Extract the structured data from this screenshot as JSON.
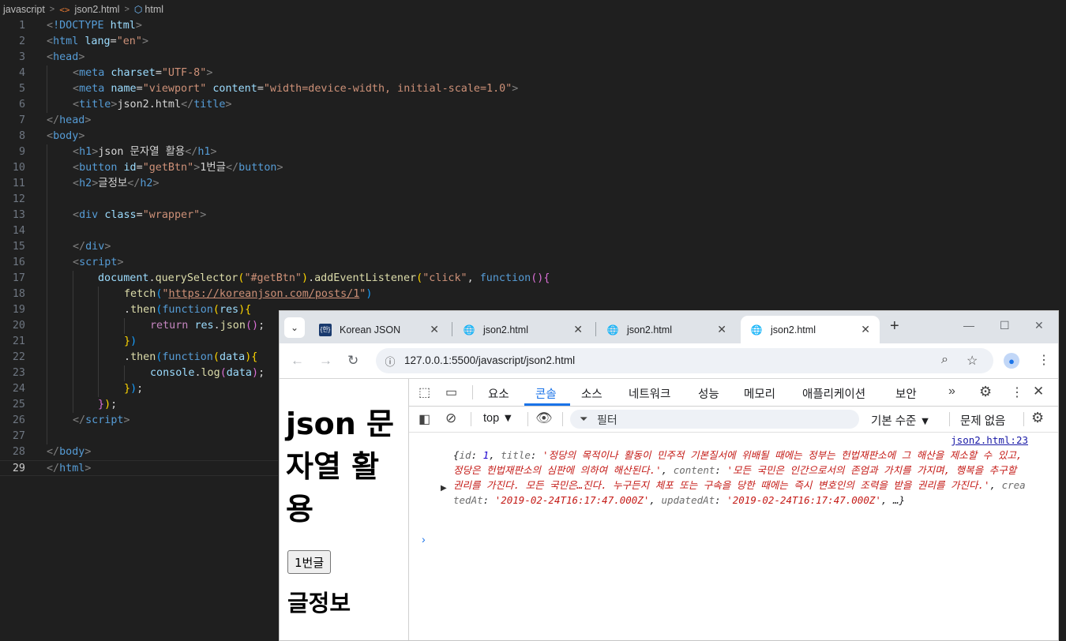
{
  "editor": {
    "breadcrumb": [
      "javascript",
      "json2.html",
      "html"
    ],
    "active_line": 29,
    "lines": [
      {
        "n": "1"
      },
      {
        "n": "2"
      },
      {
        "n": "3"
      },
      {
        "n": "4"
      },
      {
        "n": "5"
      },
      {
        "n": "6"
      },
      {
        "n": "7"
      },
      {
        "n": "8"
      },
      {
        "n": "9"
      },
      {
        "n": "10"
      },
      {
        "n": "11"
      },
      {
        "n": "12"
      },
      {
        "n": "13"
      },
      {
        "n": "14"
      },
      {
        "n": "15"
      },
      {
        "n": "16"
      },
      {
        "n": "17"
      },
      {
        "n": "18"
      },
      {
        "n": "19"
      },
      {
        "n": "20"
      },
      {
        "n": "21"
      },
      {
        "n": "22"
      },
      {
        "n": "23"
      },
      {
        "n": "24"
      },
      {
        "n": "25"
      },
      {
        "n": "26"
      },
      {
        "n": "27"
      },
      {
        "n": "28"
      },
      {
        "n": "29"
      }
    ],
    "code": {
      "doctype_kw": "!DOCTYPE",
      "doctype_val": "html",
      "html_tag": "html",
      "lang_attr": "lang",
      "lang_val": "\"en\"",
      "head_tag": "head",
      "meta_tag": "meta",
      "charset_attr": "charset",
      "charset_val": "\"UTF-8\"",
      "name_attr": "name",
      "name_val": "\"viewport\"",
      "content_attr": "content",
      "content_val": "\"width=device-width, initial-scale=1.0\"",
      "title_tag": "title",
      "title_text": "json2.html",
      "body_tag": "body",
      "h1_tag": "h1",
      "h1_text": "json 문자열 활용",
      "button_tag": "button",
      "id_attr": "id",
      "id_val": "\"getBtn\"",
      "button_text": "1번글",
      "h2_tag": "h2",
      "h2_text": "글정보",
      "div_tag": "div",
      "class_attr": "class",
      "class_val": "\"wrapper\"",
      "script_tag": "script",
      "l17_obj": "document",
      "l17_fn": "querySelector",
      "l17_arg": "\"#getBtn\"",
      "l17_fn2": "addEventListener",
      "l17_ev": "\"click\"",
      "function_kw": "function",
      "fetch_fn": "fetch",
      "fetch_q": "\"",
      "fetch_url": "https://koreanjson.com/posts/1",
      "then_fn": "then",
      "res_param": "res",
      "return_kw": "return",
      "json_fn": "json",
      "data_param": "data",
      "console_obj": "console",
      "log_fn": "log"
    }
  },
  "browser": {
    "tabs": [
      {
        "title": "Korean JSON",
        "icon": "korean-json-favicon"
      },
      {
        "title": "json2.html",
        "icon": "globe-icon"
      },
      {
        "title": "json2.html",
        "icon": "globe-icon"
      },
      {
        "title": "json2.html",
        "icon": "globe-icon",
        "active": true
      }
    ],
    "url": "127.0.0.1:5500/javascript/json2.html",
    "page": {
      "h1": "json 문자열 활용",
      "button": "1번글",
      "h2": "글정보"
    },
    "devtools": {
      "tabs": [
        "요소",
        "콘솔",
        "소스",
        "네트워크",
        "성능",
        "메모리",
        "애플리케이션",
        "보안"
      ],
      "active_tab": "콘솔",
      "context": "top ▼",
      "filter_placeholder": "필터",
      "level": "기본 수준 ▼",
      "issues": "문제 없음",
      "log": {
        "source": "json2.html:23",
        "brace_open": "{",
        "k_id": "id",
        "v_id": "1",
        "k_title": "title",
        "v_title": "'정당의 목적이나 활동이 민주적 기본질서에 위배될 때에는 정부는 헌법재판소에 그 해산을 제소할 수 있고, 정당은 헌법재판소의 심판에 의하여 해산된다.'",
        "k_content": "content",
        "v_content": "'모든 국민은 인간으로서의 존엄과 가치를 가지며, 행복을 추구할 권리를 가진다. 모든 국민은…진다. 누구든지 체포 또는 구속을 당한 때에는 즉시 변호인의 조력을 받을 권리를 가진다.'",
        "k_created": "createdAt",
        "v_created": "'2019-02-24T16:17:47.000Z'",
        "k_updated": "updatedAt",
        "v_updated": "'2019-02-24T16:17:47.000Z'",
        "tail": "…}"
      }
    }
  }
}
